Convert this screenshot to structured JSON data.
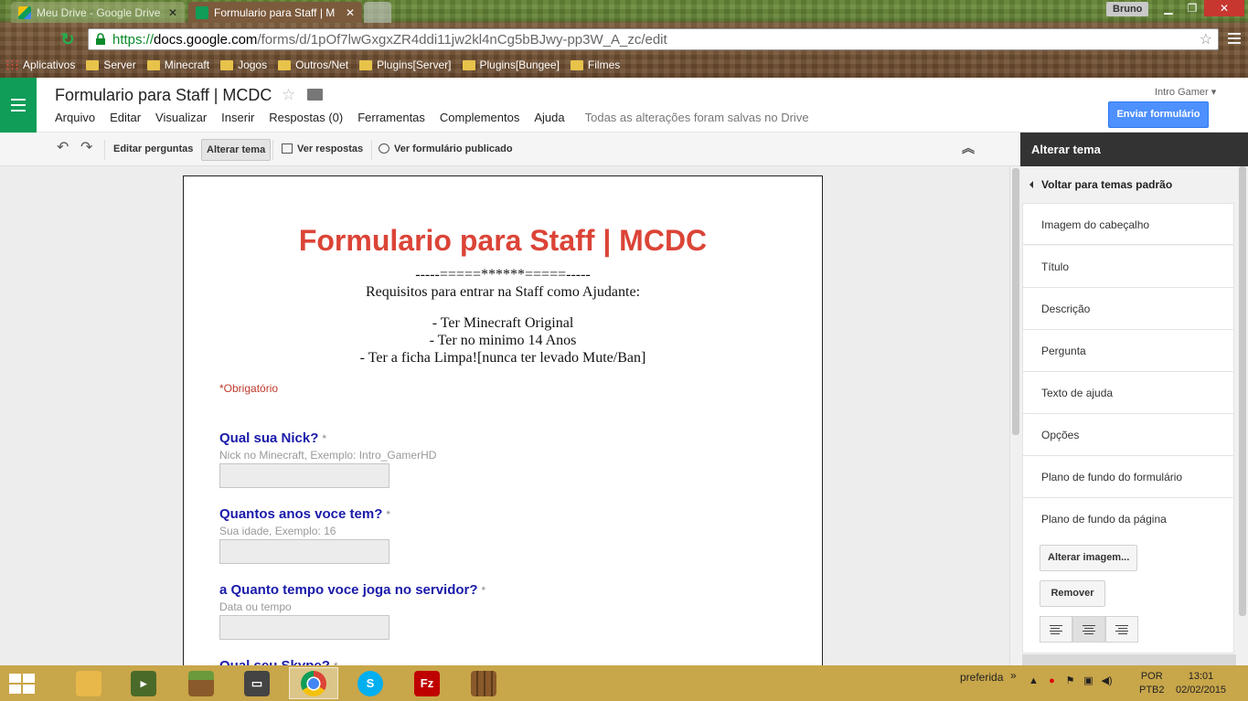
{
  "browser": {
    "tabs": [
      {
        "label": "Meu Drive - Google Drive",
        "icon": "google-drive-icon"
      },
      {
        "label": "Formulario para Staff | M",
        "icon": "google-forms-icon"
      }
    ],
    "user_name": "Bruno",
    "url": {
      "scheme": "https://",
      "domain": "docs.google.com",
      "path": "/forms/d/1pOf7lwGxgxZR4ddi11jw2kl4nCg5bBJwy-pp3W_A_zc/edit"
    },
    "bookmarks": [
      {
        "label": "Aplicativos",
        "icon": "apps-grid-icon"
      },
      {
        "label": "Server",
        "icon": "folder-icon"
      },
      {
        "label": "Minecraft",
        "icon": "folder-icon"
      },
      {
        "label": "Jogos",
        "icon": "folder-icon"
      },
      {
        "label": "Outros/Net",
        "icon": "folder-icon"
      },
      {
        "label": "Plugins[Server]",
        "icon": "folder-icon"
      },
      {
        "label": "Plugins[Bungee]",
        "icon": "folder-icon"
      },
      {
        "label": "Filmes",
        "icon": "folder-icon"
      }
    ]
  },
  "docs": {
    "title": "Formulario para Staff | MCDC",
    "menu": [
      "Arquivo",
      "Editar",
      "Visualizar",
      "Inserir",
      "Respostas (0)",
      "Ferramentas",
      "Complementos",
      "Ajuda"
    ],
    "save_status": "Todas as alterações foram salvas no Drive",
    "account": "Intro Gamer",
    "send_button": "Enviar formulário"
  },
  "toolbar": {
    "edit_questions": "Editar perguntas",
    "change_theme": "Alterar tema",
    "view_responses": "Ver respostas",
    "view_published": "Ver formulário publicado"
  },
  "form": {
    "title": "Formulario para Staff | MCDC",
    "description_lines": [
      "-----=====******=====-----",
      "Requisitos para entrar na Staff como Ajudante:",
      "",
      "- Ter Minecraft Original",
      "- Ter no minimo 14 Anos",
      "- Ter a ficha Limpa![nunca ter levado Mute/Ban]"
    ],
    "required_note": "*Obrigatório",
    "questions": [
      {
        "label": "Qual sua Nick?",
        "help": "Nick no Minecraft, Exemplo: Intro_GamerHD",
        "required": "*"
      },
      {
        "label": "Quantos anos voce tem?",
        "help": "Sua idade, Exemplo: 16",
        "required": "*"
      },
      {
        "label": "a Quanto tempo voce joga no servidor?",
        "help": "Data ou tempo",
        "required": "*"
      },
      {
        "label": "Qual seu Skype?",
        "help": "",
        "required": "*"
      }
    ]
  },
  "theme_panel": {
    "header": "Alterar tema",
    "back": "Voltar para temas padrão",
    "items": [
      "Imagem do cabeçalho",
      "Título",
      "Descrição",
      "Pergunta",
      "Texto de ajuda",
      "Opções",
      "Plano de fundo do formulário",
      "Plano de fundo da página"
    ],
    "change_image_button": "Alterar imagem...",
    "remove_button": "Remover"
  },
  "taskbar": {
    "apps": [
      {
        "name": "file-explorer-icon",
        "color": "#e8b84a"
      },
      {
        "name": "minecraft-server-icon",
        "color": "#4a6a2a"
      },
      {
        "name": "minecraft-icon",
        "color": "#6a8a3a"
      },
      {
        "name": "monitor-app-icon",
        "color": "#444444"
      },
      {
        "name": "chrome-icon",
        "color": "#4285f4"
      },
      {
        "name": "skype-icon",
        "color": "#00aff0"
      },
      {
        "name": "filezilla-icon",
        "color": "#bf0000"
      },
      {
        "name": "crafting-table-icon",
        "color": "#8a5a2a"
      }
    ],
    "tray_label": "preferida",
    "lang_top": "POR",
    "lang_bottom": "PTB2",
    "time": "13:01",
    "date": "02/02/2015"
  },
  "colors": {
    "form_title": "#db4437",
    "question_label": "#1a1aaa",
    "forms_green": "#0f9d58",
    "send_blue": "#4d90fe"
  }
}
